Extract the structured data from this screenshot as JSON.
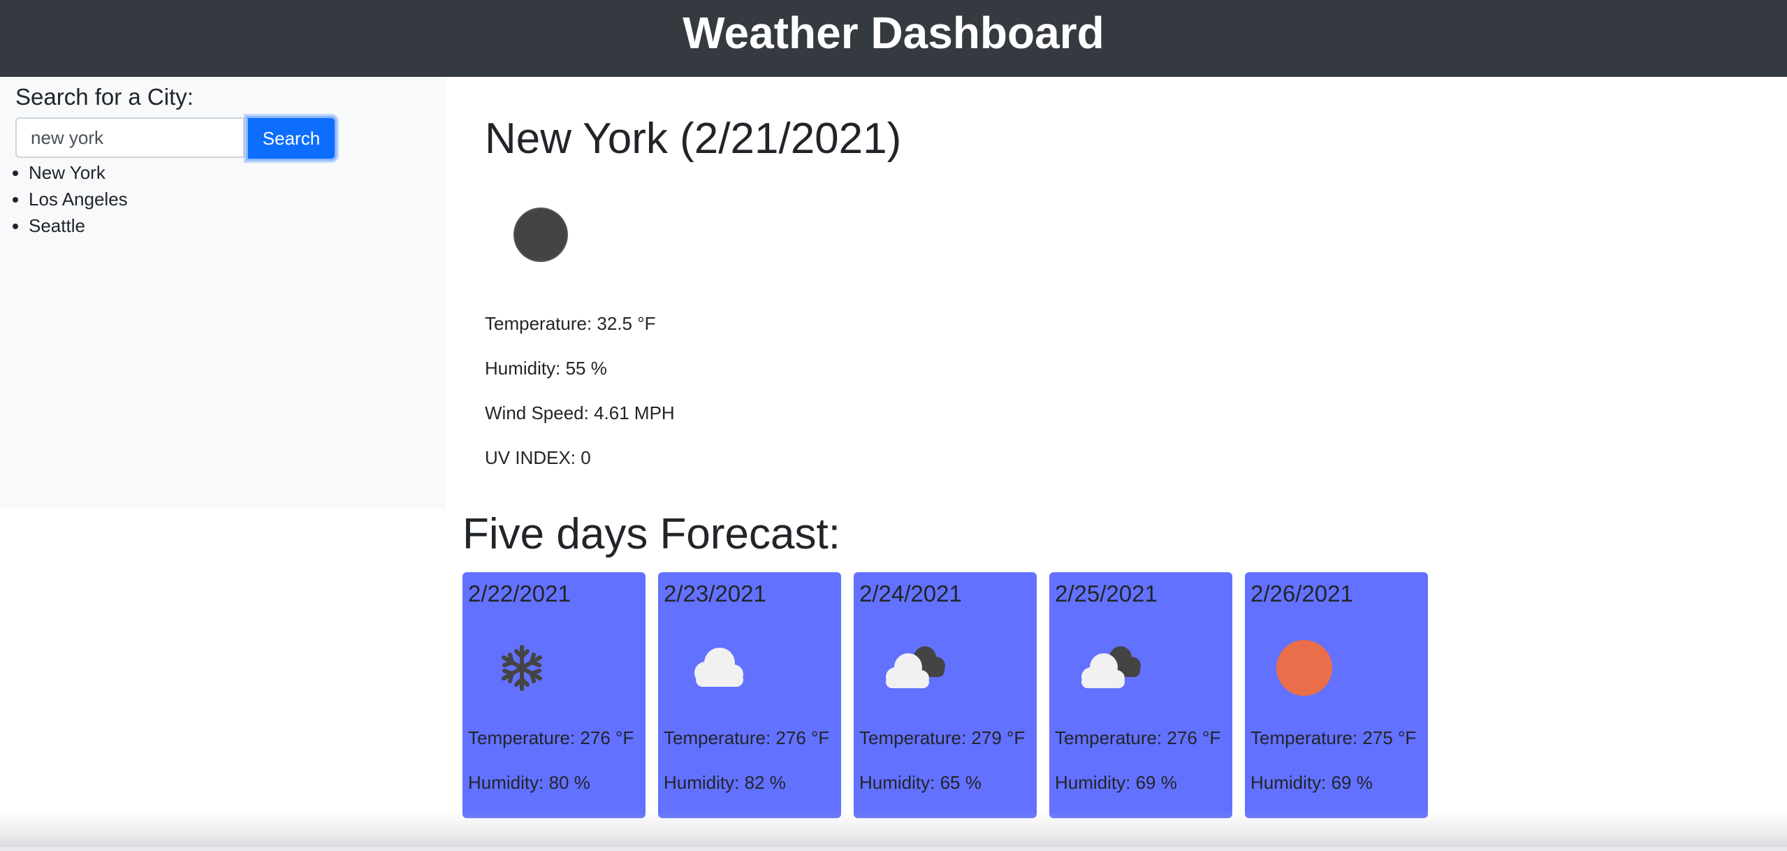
{
  "header": {
    "title": "Weather Dashboard"
  },
  "search": {
    "label": "Search for a City:",
    "value": "new york",
    "button_label": "Search",
    "history": [
      "New York",
      "Los Angeles",
      "Seattle"
    ]
  },
  "current": {
    "title": "New York (2/21/2021)",
    "icon": "moon-icon",
    "temperature": "Temperature: 32.5 °F",
    "humidity": "Humidity: 55 %",
    "wind": "Wind Speed: 4.61 MPH",
    "uv": "UV INDEX: 0"
  },
  "forecast": {
    "title": "Five days Forecast:",
    "days": [
      {
        "date": "2/22/2021",
        "icon": "snowflake-icon",
        "temperature": "Temperature: 276 °F",
        "humidity": "Humidity: 80 %"
      },
      {
        "date": "2/23/2021",
        "icon": "cloud-icon",
        "temperature": "Temperature: 276 °F",
        "humidity": "Humidity: 82 %"
      },
      {
        "date": "2/24/2021",
        "icon": "broken-clouds-icon",
        "temperature": "Temperature: 279 °F",
        "humidity": "Humidity: 65 %"
      },
      {
        "date": "2/25/2021",
        "icon": "broken-clouds-icon",
        "temperature": "Temperature: 276 °F",
        "humidity": "Humidity: 69 %"
      },
      {
        "date": "2/26/2021",
        "icon": "sun-icon",
        "temperature": "Temperature: 275 °F",
        "humidity": "Humidity: 69 %"
      }
    ]
  },
  "colors": {
    "header_bg": "#343a40",
    "sidebar_bg": "#f8f9fa",
    "button_bg": "#0d6efd",
    "card_bg": "#6371ff",
    "sun": "#eb6e4b",
    "cloud": "#f1f1f1",
    "dark_icon": "#444444"
  }
}
